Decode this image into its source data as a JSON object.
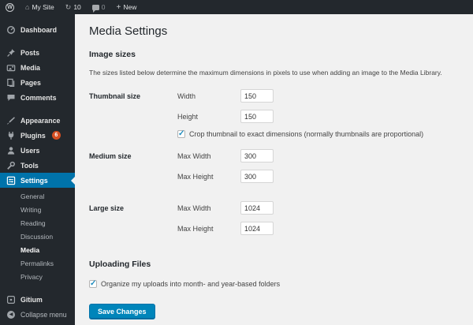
{
  "colors": {
    "admin_bar_bg": "#23282d",
    "sidebar_bg": "#23282d",
    "active_item_blue": "#0073aa",
    "button_blue": "#0085ba",
    "badge_red": "#d54e21",
    "content_bg": "#f1f1f1",
    "checkmark_blue": "#1e8cbe"
  },
  "admin_bar": {
    "logo": "W",
    "site_name": "My Site",
    "update_count": "10",
    "comment_count": "0",
    "new_label": "New"
  },
  "sidebar": {
    "items": [
      {
        "label": "Dashboard"
      },
      {
        "label": "Posts"
      },
      {
        "label": "Media"
      },
      {
        "label": "Pages"
      },
      {
        "label": "Comments"
      },
      {
        "label": "Appearance"
      },
      {
        "label": "Plugins",
        "badge": "6"
      },
      {
        "label": "Users"
      },
      {
        "label": "Tools"
      },
      {
        "label": "Settings"
      }
    ],
    "submenu": [
      "General",
      "Writing",
      "Reading",
      "Discussion",
      "Media",
      "Permalinks",
      "Privacy"
    ],
    "submenu_current": "Media",
    "gitium": "Gitium",
    "collapse": "Collapse menu"
  },
  "main": {
    "title": "Media Settings",
    "image_sizes": {
      "heading": "Image sizes",
      "description": "The sizes listed below determine the maximum dimensions in pixels to use when adding an image to the Media Library.",
      "thumbnail": {
        "label": "Thumbnail size",
        "width_label": "Width",
        "width_value": "150",
        "height_label": "Height",
        "height_value": "150",
        "crop_label": "Crop thumbnail to exact dimensions (normally thumbnails are proportional)",
        "crop_checked": true
      },
      "medium": {
        "label": "Medium size",
        "width_label": "Max Width",
        "width_value": "300",
        "height_label": "Max Height",
        "height_value": "300"
      },
      "large": {
        "label": "Large size",
        "width_label": "Max Width",
        "width_value": "1024",
        "height_label": "Max Height",
        "height_value": "1024"
      }
    },
    "uploading": {
      "heading": "Uploading Files",
      "organize_label": "Organize my uploads into month- and year-based folders",
      "organize_checked": true
    },
    "save_button": "Save Changes"
  }
}
